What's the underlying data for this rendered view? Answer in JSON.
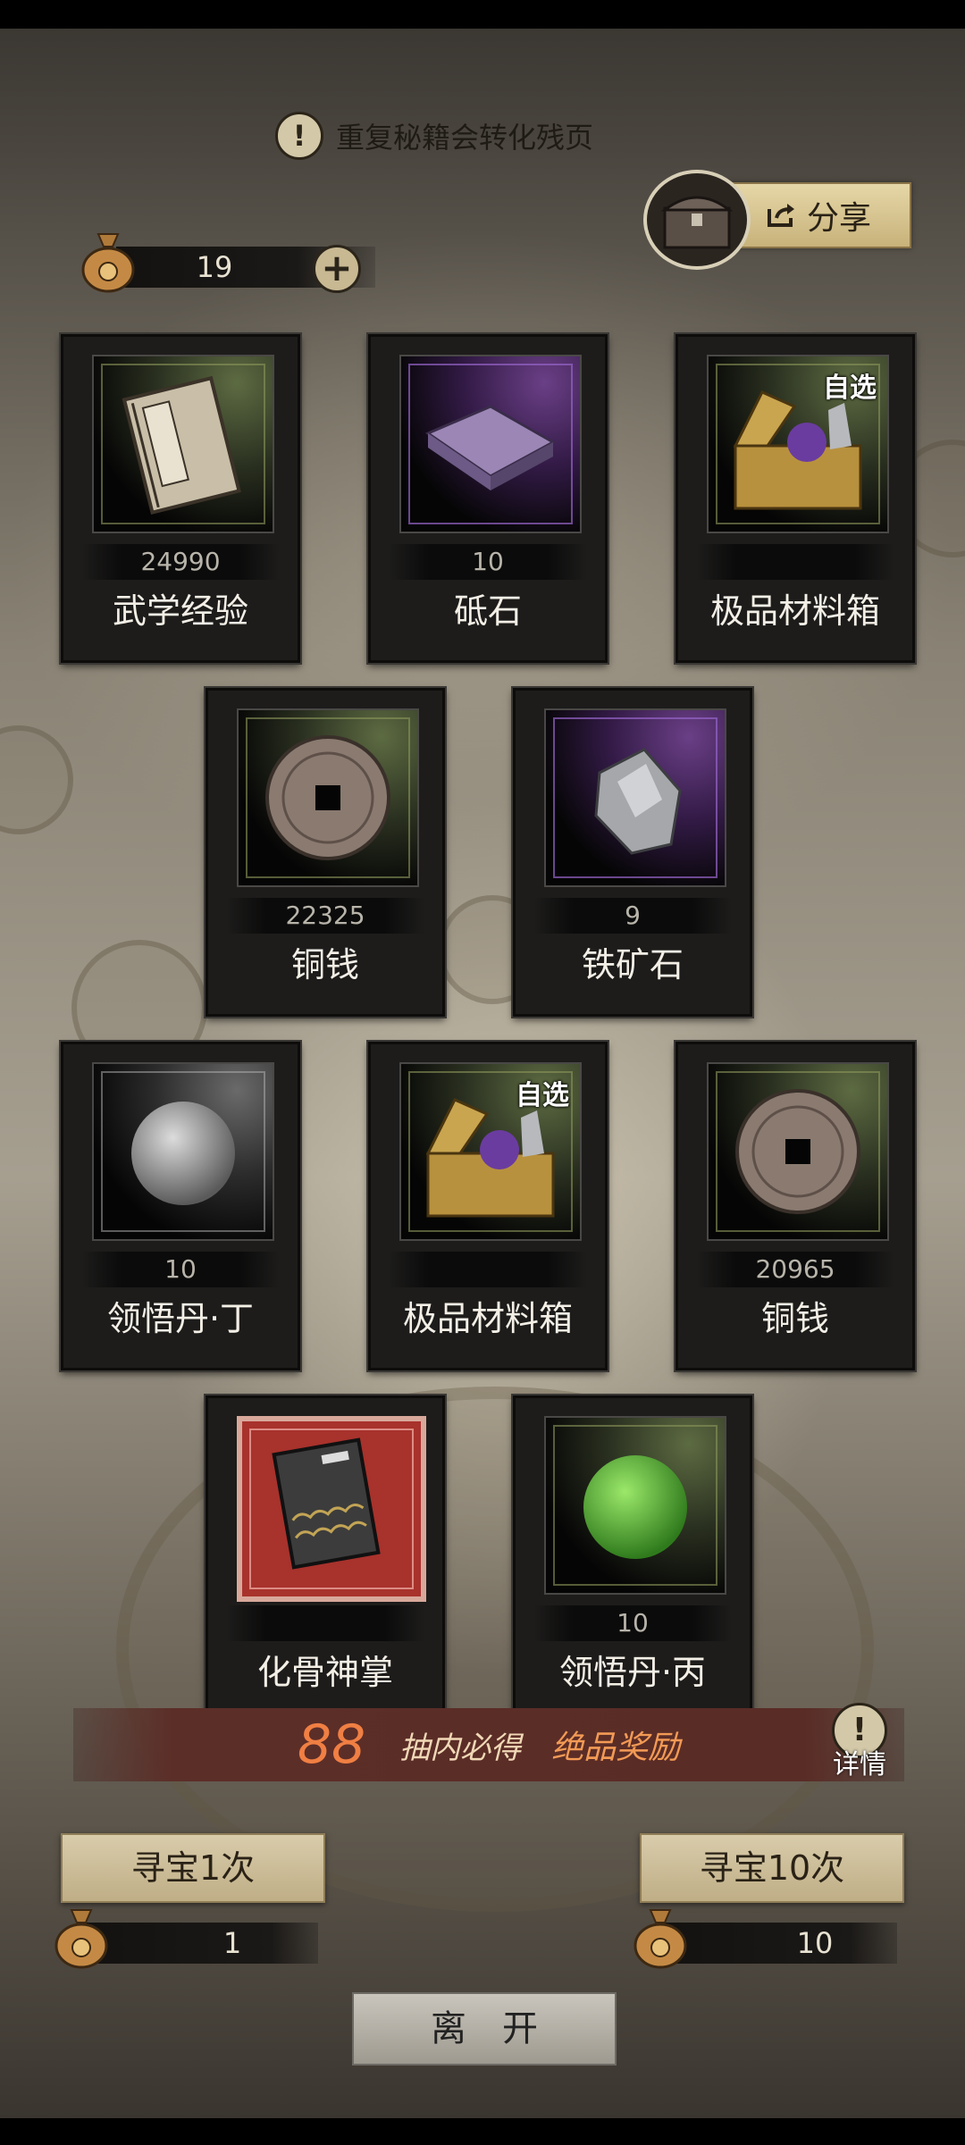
{
  "notice": {
    "text": "重复秘籍会转化残页"
  },
  "share": {
    "label": "分享"
  },
  "currency": {
    "amount": "19"
  },
  "items": [
    {
      "count": "24990",
      "name": "武学经验",
      "tag": "",
      "bg": "green",
      "icon": "martial-manual-icon"
    },
    {
      "count": "10",
      "name": "砥石",
      "tag": "",
      "bg": "purple",
      "icon": "whetstone-icon"
    },
    {
      "count": "",
      "name": "极品材料箱",
      "tag": "自选",
      "bg": "green",
      "icon": "material-chest-icon"
    },
    {
      "count": "22325",
      "name": "铜钱",
      "tag": "",
      "bg": "green",
      "icon": "copper-coin-icon"
    },
    {
      "count": "9",
      "name": "铁矿石",
      "tag": "",
      "bg": "purple",
      "icon": "iron-ore-icon"
    },
    {
      "count": "10",
      "name": "领悟丹·丁",
      "tag": "",
      "bg": "gray",
      "icon": "gray-pill-icon"
    },
    {
      "count": "",
      "name": "极品材料箱",
      "tag": "自选",
      "bg": "green",
      "icon": "material-chest-icon"
    },
    {
      "count": "20965",
      "name": "铜钱",
      "tag": "",
      "bg": "green",
      "icon": "copper-coin-icon"
    },
    {
      "count": "",
      "name": "化骨神掌",
      "tag": "",
      "bg": "red",
      "icon": "secret-manual-icon"
    },
    {
      "count": "10",
      "name": "领悟丹·丙",
      "tag": "",
      "bg": "green",
      "icon": "green-pill-icon"
    }
  ],
  "banner": {
    "number": "88",
    "text1": "抽内必得",
    "text2": "绝品奖励"
  },
  "detail": {
    "label": "详情"
  },
  "draw_once": {
    "label": "寻宝1次",
    "cost": "1"
  },
  "draw_ten": {
    "label": "寻宝10次",
    "cost": "10"
  },
  "leave": {
    "label": "离开"
  }
}
